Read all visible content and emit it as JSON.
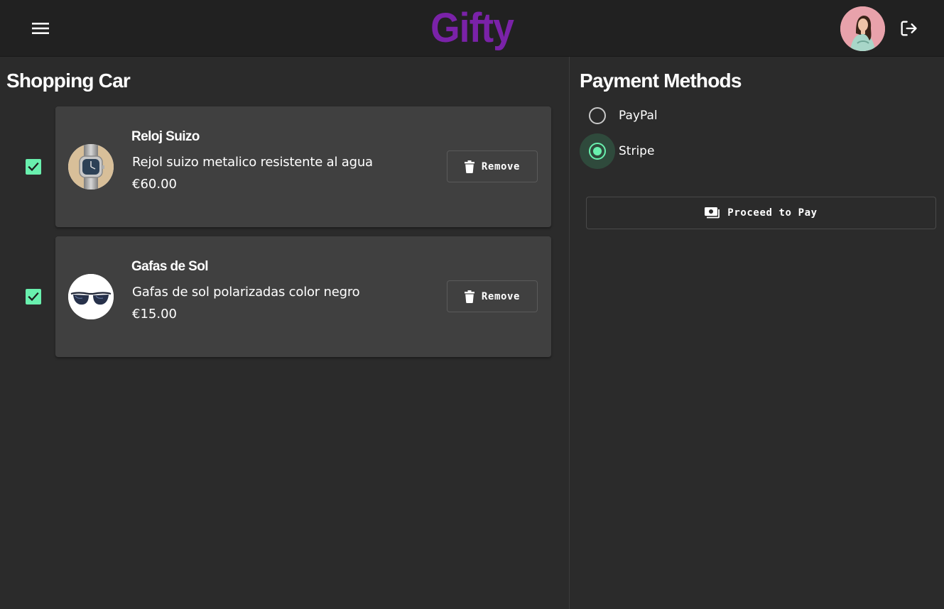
{
  "app": {
    "logo": "Gifty"
  },
  "header": {
    "menu_icon": "menu-icon",
    "avatar_icon": "user-avatar",
    "logout_icon": "logout-icon"
  },
  "cart": {
    "title": "Shopping Car",
    "items": [
      {
        "name": "Reloj Suizo",
        "description": "Rejol suizo metalico resistente al agua",
        "price": "€60.00",
        "checked": true,
        "image_icon": "watch-image",
        "remove_label": "Remove"
      },
      {
        "name": "Gafas de Sol",
        "description": "Gafas de sol polarizadas color negro",
        "price": "€15.00",
        "checked": true,
        "image_icon": "sunglasses-image",
        "remove_label": "Remove"
      }
    ]
  },
  "payment": {
    "title": "Payment Methods",
    "options": [
      {
        "label": "PayPal",
        "selected": false
      },
      {
        "label": "Stripe",
        "selected": true
      }
    ],
    "proceed_label": "Proceed to Pay"
  },
  "colors": {
    "accent": "#69f0ae",
    "brand": "#7a22a8",
    "appbar_bg": "#212121",
    "page_bg": "#2b2b2b",
    "card_bg": "#404040"
  }
}
